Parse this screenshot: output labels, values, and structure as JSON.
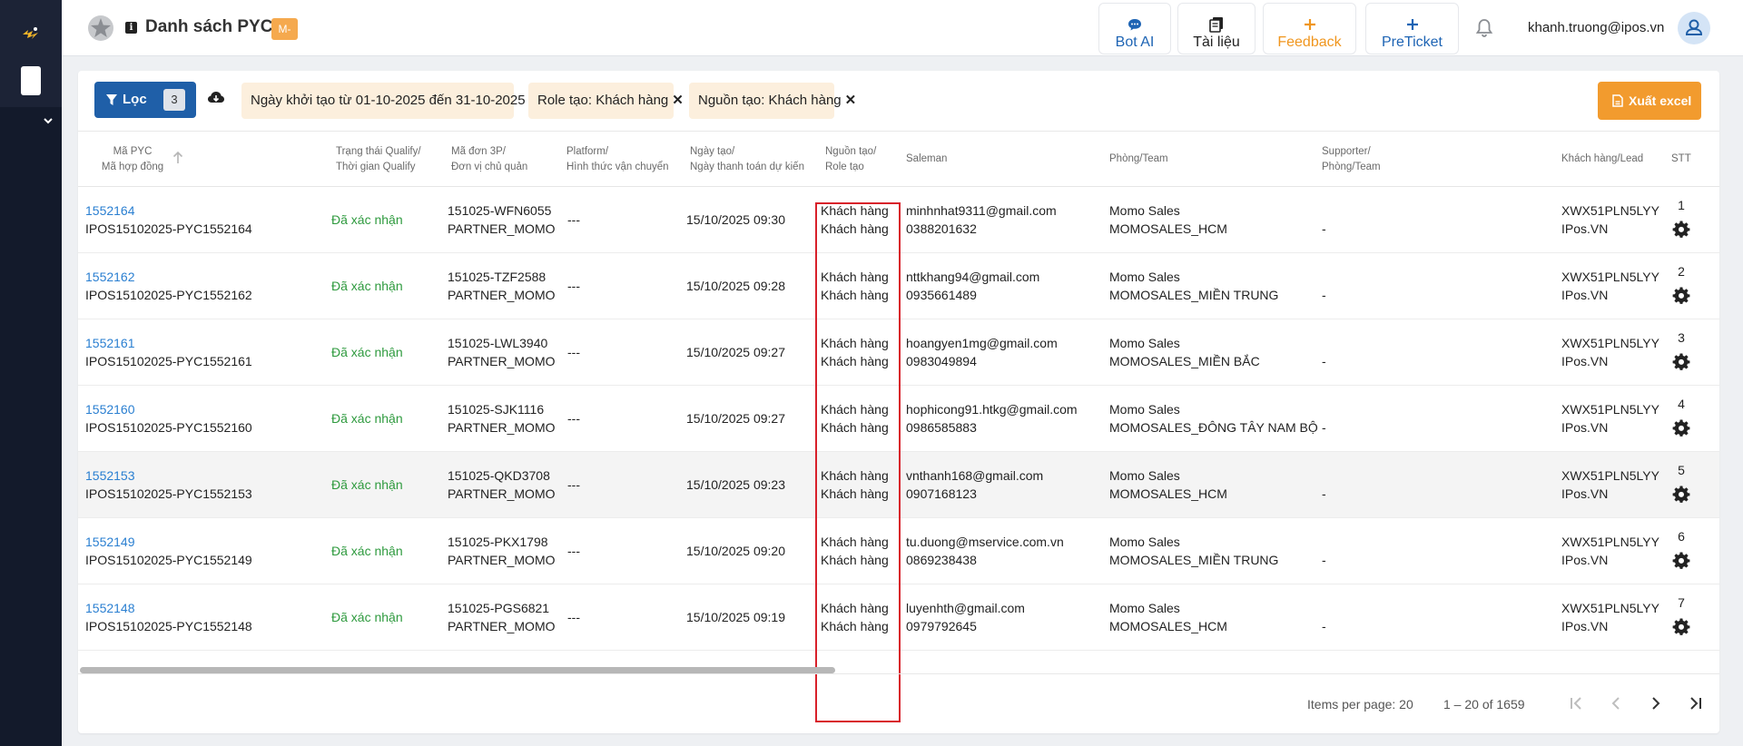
{
  "header": {
    "title": "Danh sách PYC",
    "badge": "M-",
    "buttons": [
      {
        "label": "Bot AI"
      },
      {
        "label": "Tài liệu"
      },
      {
        "label": "Feedback"
      },
      {
        "label": "PreTicket"
      }
    ],
    "user_email": "khanh.truong@ipos.vn"
  },
  "filters": {
    "filter_label": "Lọc",
    "filter_count": "3",
    "chips": [
      {
        "label": "Ngày khởi tạo từ 01-10-2025 đến 31-10-2025"
      },
      {
        "label": "Role tạo: Khách hàng"
      },
      {
        "label": "Nguồn tạo: Khách hàng"
      }
    ],
    "export_label": "Xuất excel"
  },
  "table": {
    "columns": [
      {
        "line1": "Mã PYC",
        "line2": "Mã hợp đồng"
      },
      {
        "line1": "Trạng thái Qualify/",
        "line2": "Thời gian Qualify"
      },
      {
        "line1": "Mã đơn 3P/",
        "line2": "Đơn vị chủ quản"
      },
      {
        "line1": "Platform/",
        "line2": "Hình thức vận chuyển"
      },
      {
        "line1": "Ngày tạo/",
        "line2": "Ngày thanh toán dự kiến"
      },
      {
        "line1": "Nguồn tạo/",
        "line2": "Role tạo"
      },
      {
        "line1": "Saleman",
        "line2": ""
      },
      {
        "line1": "Phòng/Team",
        "line2": ""
      },
      {
        "line1": "Supporter/",
        "line2": "Phòng/Team"
      },
      {
        "line1": "Khách hàng/Lead",
        "line2": ""
      },
      {
        "line1": "STT",
        "line2": ""
      }
    ],
    "rows": [
      {
        "pyc": "1552164",
        "contract": "IPOS15102025-PYC1552164",
        "status": "Đã xác nhận",
        "order": "151025-WFN6055",
        "unit": "PARTNER_MOMO",
        "platform": "---",
        "created": "15/10/2025 09:30",
        "source": "Khách hàng",
        "role": "Khách hàng",
        "sale_email": "minhnhat9311@gmail.com",
        "sale_phone": "0388201632",
        "team": "Momo Sales",
        "team_sub": "MOMOSALES_HCM",
        "supporter": "-",
        "customer": "XWX51PLN5LYY",
        "customer_sub": "IPos.VN",
        "stt": "1"
      },
      {
        "pyc": "1552162",
        "contract": "IPOS15102025-PYC1552162",
        "status": "Đã xác nhận",
        "order": "151025-TZF2588",
        "unit": "PARTNER_MOMO",
        "platform": "---",
        "created": "15/10/2025 09:28",
        "source": "Khách hàng",
        "role": "Khách hàng",
        "sale_email": "nttkhang94@gmail.com",
        "sale_phone": "0935661489",
        "team": "Momo Sales",
        "team_sub": "MOMOSALES_MIỀN TRUNG",
        "supporter": "-",
        "customer": "XWX51PLN5LYY",
        "customer_sub": "IPos.VN",
        "stt": "2"
      },
      {
        "pyc": "1552161",
        "contract": "IPOS15102025-PYC1552161",
        "status": "Đã xác nhận",
        "order": "151025-LWL3940",
        "unit": "PARTNER_MOMO",
        "platform": "---",
        "created": "15/10/2025 09:27",
        "source": "Khách hàng",
        "role": "Khách hàng",
        "sale_email": "hoangyen1mg@gmail.com",
        "sale_phone": "0983049894",
        "team": "Momo Sales",
        "team_sub": "MOMOSALES_MIỀN BẮC",
        "supporter": "-",
        "customer": "XWX51PLN5LYY",
        "customer_sub": "IPos.VN",
        "stt": "3"
      },
      {
        "pyc": "1552160",
        "contract": "IPOS15102025-PYC1552160",
        "status": "Đã xác nhận",
        "order": "151025-SJK1116",
        "unit": "PARTNER_MOMO",
        "platform": "---",
        "created": "15/10/2025 09:27",
        "source": "Khách hàng",
        "role": "Khách hàng",
        "sale_email": "hophicong91.htkg@gmail.com",
        "sale_phone": "0986585883",
        "team": "Momo Sales",
        "team_sub": "MOMOSALES_ĐÔNG TÂY NAM BỘ",
        "supporter": "-",
        "customer": "XWX51PLN5LYY",
        "customer_sub": "IPos.VN",
        "stt": "4"
      },
      {
        "pyc": "1552153",
        "contract": "IPOS15102025-PYC1552153",
        "status": "Đã xác nhận",
        "order": "151025-QKD3708",
        "unit": "PARTNER_MOMO",
        "platform": "---",
        "created": "15/10/2025 09:23",
        "source": "Khách hàng",
        "role": "Khách hàng",
        "sale_email": "vnthanh168@gmail.com",
        "sale_phone": "0907168123",
        "team": "Momo Sales",
        "team_sub": "MOMOSALES_HCM",
        "supporter": "-",
        "customer": "XWX51PLN5LYY",
        "customer_sub": "IPos.VN",
        "stt": "5"
      },
      {
        "pyc": "1552149",
        "contract": "IPOS15102025-PYC1552149",
        "status": "Đã xác nhận",
        "order": "151025-PKX1798",
        "unit": "PARTNER_MOMO",
        "platform": "---",
        "created": "15/10/2025 09:20",
        "source": "Khách hàng",
        "role": "Khách hàng",
        "sale_email": "tu.duong@mservice.com.vn",
        "sale_phone": "0869238438",
        "team": "Momo Sales",
        "team_sub": "MOMOSALES_MIỀN TRUNG",
        "supporter": "-",
        "customer": "XWX51PLN5LYY",
        "customer_sub": "IPos.VN",
        "stt": "6"
      },
      {
        "pyc": "1552148",
        "contract": "IPOS15102025-PYC1552148",
        "status": "Đã xác nhận",
        "order": "151025-PGS6821",
        "unit": "PARTNER_MOMO",
        "platform": "---",
        "created": "15/10/2025 09:19",
        "source": "Khách hàng",
        "role": "Khách hàng",
        "sale_email": "luyenhth@gmail.com",
        "sale_phone": "0979792645",
        "team": "Momo Sales",
        "team_sub": "MOMOSALES_HCM",
        "supporter": "-",
        "customer": "XWX51PLN5LYY",
        "customer_sub": "IPos.VN",
        "stt": "7"
      }
    ]
  },
  "pagination": {
    "items_per_page": "Items per page: 20",
    "range": "1 – 20 of 1659"
  },
  "colors": {
    "primary": "#1f5fa8",
    "accent": "#f29b2e",
    "status_green": "#2e9a3e",
    "link_blue": "#2a7fd1",
    "highlight_red": "#d8202a"
  }
}
